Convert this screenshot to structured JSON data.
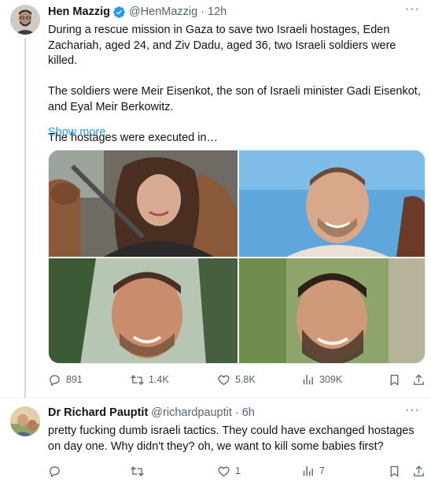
{
  "tweets": [
    {
      "author": {
        "name": "Hen Mazzig",
        "handle": "@HenMazzig"
      },
      "time": "12h",
      "text": {
        "p1": "During a rescue mission in Gaza to save two Israeli hostages, Eden Zachariah, aged 24, and Ziv Dadu, aged 36, two Israeli soldiers were killed.",
        "p2": "The soldiers were Meir Eisenkot, the son of Israeli minister Gadi Eisenkot, and Eyal Meir Berkowitz.",
        "p3": "The hostages were executed in…"
      },
      "show_more": "Show more",
      "stats": {
        "replies": "891",
        "retweets": "1.4K",
        "likes": "5.8K",
        "views": "309K"
      }
    },
    {
      "author": {
        "name": "Dr Richard Pauptit",
        "handle": "@richardpauptit"
      },
      "time": "6h",
      "text": "pretty fucking dumb israeli tactics. They could have exchanged hostages on day one. Why didn't they? oh, we want to kill some babies first?",
      "stats": {
        "replies": "",
        "retweets": "",
        "likes": "1",
        "views": "7"
      }
    }
  ],
  "icons": {
    "verified": "verified-badge-icon",
    "more": "more-icon",
    "reply": "reply-icon",
    "retweet": "retweet-icon",
    "like": "heart-icon",
    "views": "views-icon",
    "bookmark": "bookmark-icon",
    "share": "share-icon"
  },
  "colors": {
    "link": "#1d9bf0",
    "secondary": "#536471",
    "text": "#0f1419",
    "verified": "#1d9bf0"
  }
}
